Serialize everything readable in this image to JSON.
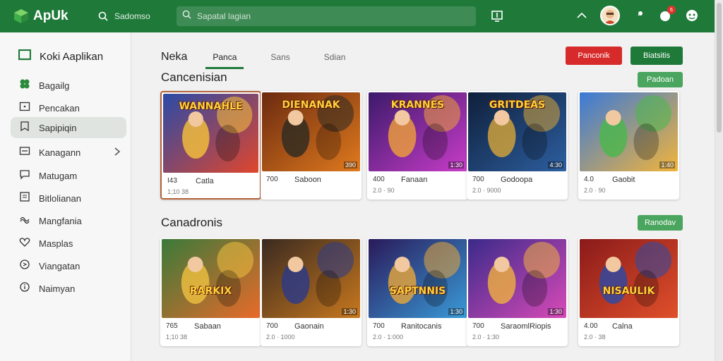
{
  "app": {
    "name": "ApUk"
  },
  "topbar": {
    "search_label": "Sadomso",
    "search_placeholder": "Sapatal lagian",
    "badge_count": "6"
  },
  "sidebar": {
    "title": "Koki Aaplikan",
    "items": [
      {
        "label": "Bagailg",
        "icon": "clover-icon",
        "active": false
      },
      {
        "label": "Pencakan",
        "icon": "download-icon",
        "active": false
      },
      {
        "label": "Sapipiqin",
        "icon": "bookmark-icon",
        "active": true
      },
      {
        "label": "Kanagann",
        "icon": "folder-icon",
        "active": false
      },
      {
        "label": "Matugam",
        "icon": "chat-icon",
        "active": false
      },
      {
        "label": "Bitlolianan",
        "icon": "document-icon",
        "active": false
      },
      {
        "label": "Mangfania",
        "icon": "wave-icon",
        "active": false
      },
      {
        "label": "Masplas",
        "icon": "heart-icon",
        "active": false
      },
      {
        "label": "Viangatan",
        "icon": "refresh-icon",
        "active": false
      },
      {
        "label": "Naimyan",
        "icon": "info-icon",
        "active": false
      }
    ]
  },
  "main": {
    "page_title": "Neka",
    "tabs": [
      {
        "label": "Panca",
        "active": true
      },
      {
        "label": "Sans",
        "active": false
      },
      {
        "label": "Sdian",
        "active": false
      }
    ],
    "buttons": {
      "red": "Panconik",
      "green": "Biatsitis"
    }
  },
  "sections": [
    {
      "title": "Cancenisian",
      "see_all": "Padoan",
      "cards": [
        {
          "rating": "I43",
          "name": "Catla",
          "meta": "1;10 38",
          "size": "",
          "selected": true,
          "title_text": "WANNAHLE",
          "palette": [
            "#2a4aa8",
            "#e0462c",
            "#f7c33a"
          ]
        },
        {
          "rating": "700",
          "name": "Saboon",
          "meta": "",
          "size": "390",
          "selected": false,
          "title_text": "DIENANAK",
          "palette": [
            "#6b2a10",
            "#e07a1e",
            "#2c2a22"
          ]
        },
        {
          "rating": "400",
          "name": "Fanaan",
          "meta": "2.0 · 90",
          "size": "1:30",
          "selected": false,
          "title_text": "KRANNES",
          "palette": [
            "#3b1a6a",
            "#c83cc8",
            "#f0a03a"
          ]
        },
        {
          "rating": "700",
          "name": "Godoopa",
          "meta": "2.0 · 9000",
          "size": "4:30",
          "selected": false,
          "title_text": "GRITDEAS",
          "palette": [
            "#0f1f3a",
            "#2d5fa0",
            "#d8a63a"
          ]
        },
        {
          "rating": "4.0",
          "name": "Gaobit",
          "meta": "2.0 · 90",
          "size": "1:40",
          "selected": false,
          "title_text": "",
          "palette": [
            "#3a7ad8",
            "#f2b43a",
            "#4ab84a"
          ]
        }
      ]
    },
    {
      "title": "Canadronis",
      "see_all": "Ranodav",
      "cards": [
        {
          "rating": "765",
          "name": "Sabaan",
          "meta": "1;10 38",
          "size": "",
          "selected": false,
          "title_text": "RARKIX",
          "palette": [
            "#3a7a3a",
            "#e86a2a",
            "#f0c040"
          ]
        },
        {
          "rating": "700",
          "name": "Gaonain",
          "meta": "2.0 · 1000",
          "size": "1:30",
          "selected": false,
          "title_text": "",
          "palette": [
            "#3a2a20",
            "#c8781e",
            "#2a3a8a"
          ]
        },
        {
          "rating": "700",
          "name": "Ranitocanis",
          "meta": "2.0 · 1:000",
          "size": "1:30",
          "selected": false,
          "title_text": "SAPTNNIS",
          "palette": [
            "#2a1a5a",
            "#3a9ad8",
            "#e8a83a"
          ]
        },
        {
          "rating": "700",
          "name": "SaraomlRiopis",
          "meta": "2.0 · 1:30",
          "size": "1:30",
          "selected": false,
          "title_text": "",
          "palette": [
            "#3a2a8a",
            "#d84ab8",
            "#f0b040"
          ]
        },
        {
          "rating": "4.00",
          "name": "Calna",
          "meta": "2.0 · 38",
          "size": "",
          "selected": false,
          "title_text": "NISAULIK",
          "palette": [
            "#8a1a1a",
            "#e0502a",
            "#2a4aa8"
          ]
        }
      ]
    }
  ]
}
